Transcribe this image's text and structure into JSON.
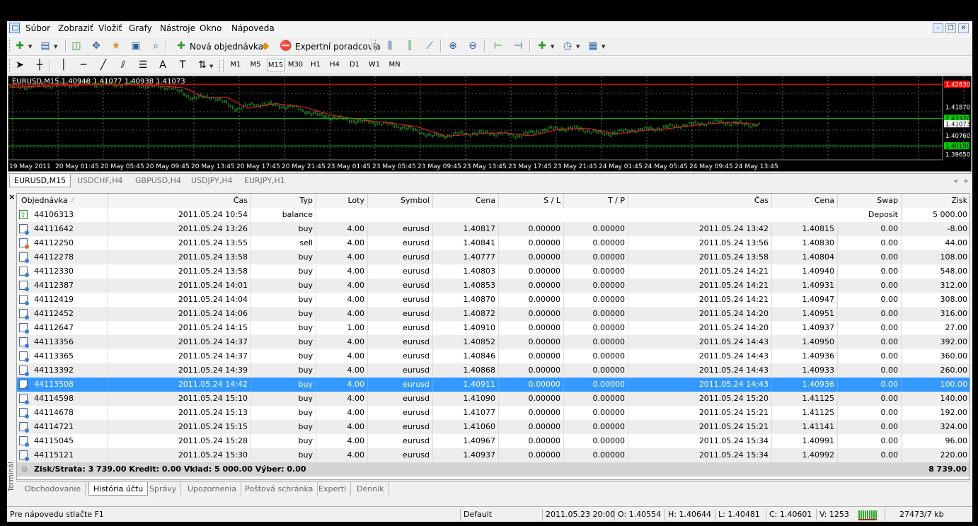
{
  "menu": [
    "Súbor",
    "Zobraziť",
    "Vložiť",
    "Grafy",
    "Nástroje",
    "Okno",
    "Nápoveda"
  ],
  "toolbar": {
    "new_order": "Nová objednávka",
    "expert_advisors": "Expertní poradcovia"
  },
  "timeframes": [
    "M1",
    "M5",
    "M15",
    "M30",
    "H1",
    "H4",
    "D1",
    "W1",
    "MN"
  ],
  "active_timeframe": "M15",
  "chart": {
    "label": "EURUSD,M15  1.40948 1.41077 1.40938 1.41073",
    "price_labels": [
      "1.42830",
      "1.41870",
      "1.41370",
      "1.41073",
      "1.40760",
      "1.40190",
      "1.39650"
    ],
    "time_labels": [
      "19 May 2011",
      "20 May 01:45",
      "20 May 05:45",
      "20 May 09:45",
      "20 May 13:45",
      "20 May 17:45",
      "20 May 21:45",
      "23 May 01:45",
      "23 May 05:45",
      "23 May 09:45",
      "23 May 13:45",
      "23 May 17:45",
      "23 May 21:45",
      "24 May 01:45",
      "24 May 05:45",
      "24 May 09:45",
      "24 May 13:45"
    ],
    "colors": {
      "background": "#000000",
      "bars": "#22dd22",
      "ma": "#ff2020",
      "resistance": "#ff0000",
      "support": "#00cc00"
    }
  },
  "chart_tabs": [
    "EURUSD,M15",
    "USDCHF,H4",
    "GBPUSD,H4",
    "USDJPY,H4",
    "EURJPY,H1"
  ],
  "terminal": {
    "side_label": "Terminál",
    "columns": [
      "Objednávka",
      "Čas",
      "Typ",
      "Loty",
      "Symbol",
      "Cena",
      "S / L",
      "T / P",
      "Čas",
      "Cena",
      "Swap",
      "Zisk"
    ],
    "balance_row": {
      "order": "44106313",
      "time": "2011.05.24 10:54",
      "type": "balance",
      "comment": "Deposit",
      "profit": "5 000.00"
    },
    "rows": [
      {
        "order": "44111642",
        "open_time": "2011.05.24 13:26",
        "type": "buy",
        "lots": "4.00",
        "symbol": "eurusd",
        "price": "1.40817",
        "sl": "0.00000",
        "tp": "0.00000",
        "close_time": "2011.05.24 13:42",
        "close_price": "1.40815",
        "swap": "0.00",
        "profit": "-8.00"
      },
      {
        "order": "44112250",
        "open_time": "2011.05.24 13:55",
        "type": "sell",
        "lots": "4.00",
        "symbol": "eurusd",
        "price": "1.40841",
        "sl": "0.00000",
        "tp": "0.00000",
        "close_time": "2011.05.24 13:56",
        "close_price": "1.40830",
        "swap": "0.00",
        "profit": "44.00"
      },
      {
        "order": "44112278",
        "open_time": "2011.05.24 13:58",
        "type": "buy",
        "lots": "4.00",
        "symbol": "eurusd",
        "price": "1.40777",
        "sl": "0.00000",
        "tp": "0.00000",
        "close_time": "2011.05.24 13:58",
        "close_price": "1.40804",
        "swap": "0.00",
        "profit": "108.00"
      },
      {
        "order": "44112330",
        "open_time": "2011.05.24 13:58",
        "type": "buy",
        "lots": "4.00",
        "symbol": "eurusd",
        "price": "1.40803",
        "sl": "0.00000",
        "tp": "0.00000",
        "close_time": "2011.05.24 14:21",
        "close_price": "1.40940",
        "swap": "0.00",
        "profit": "548.00"
      },
      {
        "order": "44112387",
        "open_time": "2011.05.24 14:01",
        "type": "buy",
        "lots": "4.00",
        "symbol": "eurusd",
        "price": "1.40853",
        "sl": "0.00000",
        "tp": "0.00000",
        "close_time": "2011.05.24 14:21",
        "close_price": "1.40931",
        "swap": "0.00",
        "profit": "312.00"
      },
      {
        "order": "44112419",
        "open_time": "2011.05.24 14:04",
        "type": "buy",
        "lots": "4.00",
        "symbol": "eurusd",
        "price": "1.40870",
        "sl": "0.00000",
        "tp": "0.00000",
        "close_time": "2011.05.24 14:21",
        "close_price": "1.40947",
        "swap": "0.00",
        "profit": "308.00"
      },
      {
        "order": "44112452",
        "open_time": "2011.05.24 14:06",
        "type": "buy",
        "lots": "4.00",
        "symbol": "eurusd",
        "price": "1.40872",
        "sl": "0.00000",
        "tp": "0.00000",
        "close_time": "2011.05.24 14:20",
        "close_price": "1.40951",
        "swap": "0.00",
        "profit": "316.00"
      },
      {
        "order": "44112647",
        "open_time": "2011.05.24 14:15",
        "type": "buy",
        "lots": "1.00",
        "symbol": "eurusd",
        "price": "1.40910",
        "sl": "0.00000",
        "tp": "0.00000",
        "close_time": "2011.05.24 14:20",
        "close_price": "1.40937",
        "swap": "0.00",
        "profit": "27.00"
      },
      {
        "order": "44113356",
        "open_time": "2011.05.24 14:37",
        "type": "buy",
        "lots": "4.00",
        "symbol": "eurusd",
        "price": "1.40852",
        "sl": "0.00000",
        "tp": "0.00000",
        "close_time": "2011.05.24 14:43",
        "close_price": "1.40950",
        "swap": "0.00",
        "profit": "392.00"
      },
      {
        "order": "44113365",
        "open_time": "2011.05.24 14:37",
        "type": "buy",
        "lots": "4.00",
        "symbol": "eurusd",
        "price": "1.40846",
        "sl": "0.00000",
        "tp": "0.00000",
        "close_time": "2011.05.24 14:43",
        "close_price": "1.40936",
        "swap": "0.00",
        "profit": "360.00"
      },
      {
        "order": "44113392",
        "open_time": "2011.05.24 14:39",
        "type": "buy",
        "lots": "4.00",
        "symbol": "eurusd",
        "price": "1.40868",
        "sl": "0.00000",
        "tp": "0.00000",
        "close_time": "2011.05.24 14:43",
        "close_price": "1.40933",
        "swap": "0.00",
        "profit": "260.00"
      },
      {
        "order": "44113508",
        "open_time": "2011.05.24 14:42",
        "type": "buy",
        "lots": "4.00",
        "symbol": "eurusd",
        "price": "1.40911",
        "sl": "0.00000",
        "tp": "0.00000",
        "close_time": "2011.05.24 14:43",
        "close_price": "1.40936",
        "swap": "0.00",
        "profit": "100.00",
        "selected": true
      },
      {
        "order": "44114598",
        "open_time": "2011.05.24 15:10",
        "type": "buy",
        "lots": "4.00",
        "symbol": "eurusd",
        "price": "1.41090",
        "sl": "0.00000",
        "tp": "0.00000",
        "close_time": "2011.05.24 15:20",
        "close_price": "1.41125",
        "swap": "0.00",
        "profit": "140.00"
      },
      {
        "order": "44114678",
        "open_time": "2011.05.24 15:13",
        "type": "buy",
        "lots": "4.00",
        "symbol": "eurusd",
        "price": "1.41077",
        "sl": "0.00000",
        "tp": "0.00000",
        "close_time": "2011.05.24 15:21",
        "close_price": "1.41125",
        "swap": "0.00",
        "profit": "192.00"
      },
      {
        "order": "44114721",
        "open_time": "2011.05.24 15:15",
        "type": "buy",
        "lots": "4.00",
        "symbol": "eurusd",
        "price": "1.41060",
        "sl": "0.00000",
        "tp": "0.00000",
        "close_time": "2011.05.24 15:21",
        "close_price": "1.41141",
        "swap": "0.00",
        "profit": "324.00"
      },
      {
        "order": "44115045",
        "open_time": "2011.05.24 15:28",
        "type": "buy",
        "lots": "4.00",
        "symbol": "eurusd",
        "price": "1.40967",
        "sl": "0.00000",
        "tp": "0.00000",
        "close_time": "2011.05.24 15:34",
        "close_price": "1.40991",
        "swap": "0.00",
        "profit": "96.00"
      },
      {
        "order": "44115121",
        "open_time": "2011.05.24 15:30",
        "type": "buy",
        "lots": "4.00",
        "symbol": "eurusd",
        "price": "1.40937",
        "sl": "0.00000",
        "tp": "0.00000",
        "close_time": "2011.05.24 15:34",
        "close_price": "1.40992",
        "swap": "0.00",
        "profit": "220.00"
      }
    ],
    "summary": {
      "text": "Zisk/Strata: 3 739.00  Kredit: 0.00  Vklad: 5 000.00  Výber: 0.00",
      "total": "8 739.00"
    },
    "tabs": [
      "Obchodovanie",
      "História účtu",
      "Správy",
      "Upozornenia",
      "Poštová schránka",
      "Experti",
      "Denník"
    ],
    "active_tab": "História účtu"
  },
  "statusbar": {
    "help": "Pre nápovedu stlačte F1",
    "profile": "Default",
    "datetime": "2011.05.23 20:00",
    "open": "O: 1.40554",
    "high": "H: 1.40644",
    "low": "L: 1.40481",
    "close": "C: 1.40601",
    "volume": "V: 1253",
    "traffic": "27473/7 kb"
  }
}
